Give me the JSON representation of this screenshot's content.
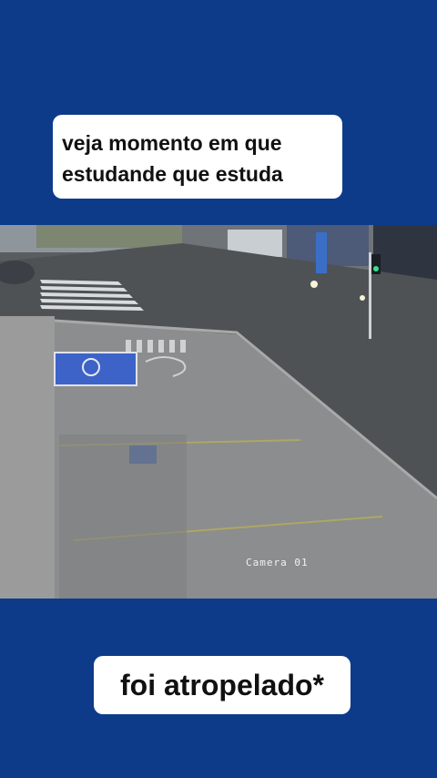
{
  "captions": {
    "top_line1": "veja momento em que",
    "top_line2": "estudande que estuda",
    "bottom": "foi atropelado*"
  },
  "video": {
    "camera_label": "Camera 01"
  },
  "colors": {
    "background": "#0d3b8a",
    "caption_bg": "#ffffff",
    "caption_text": "#111111",
    "accessible_parking_blue": "#3d63c9"
  }
}
